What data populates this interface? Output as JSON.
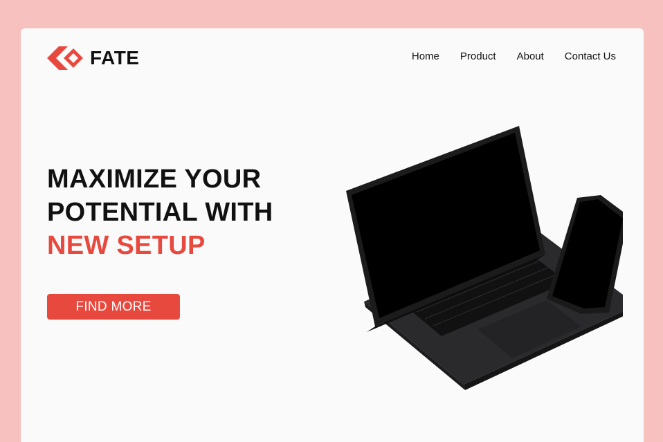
{
  "brand": {
    "name": "FATE",
    "logo_icon": "diamond-arrows-logo-icon",
    "accent_color": "#e8493f"
  },
  "nav": {
    "items": [
      {
        "label": "Home"
      },
      {
        "label": "Product"
      },
      {
        "label": "About"
      },
      {
        "label": "Contact Us"
      }
    ]
  },
  "hero": {
    "title_line1": "MAXIMIZE YOUR",
    "title_line2": "POTENTIAL WITH",
    "title_line3": "NEW SETUP",
    "cta_label": "FIND MORE",
    "image": "laptop-and-phone-illustration"
  },
  "colors": {
    "page_background": "#f6c1bf",
    "card_background": "#fafafa",
    "accent": "#e8493f",
    "text": "#111111"
  }
}
